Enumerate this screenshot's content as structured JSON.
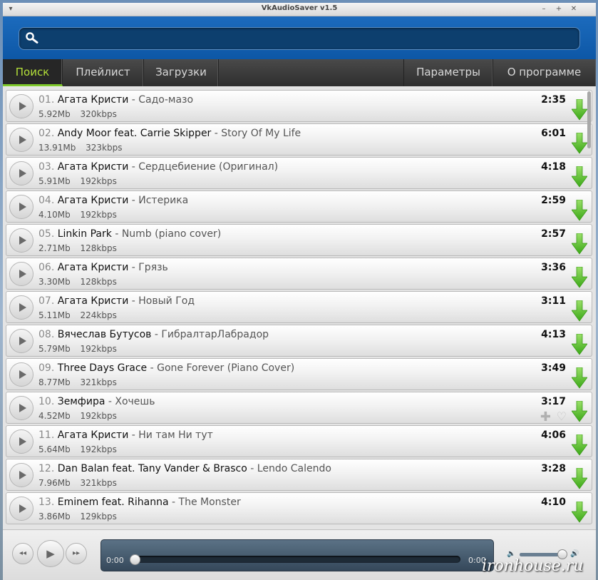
{
  "window": {
    "title": "VkAudioSaver v1.5"
  },
  "search": {
    "placeholder": "",
    "value": ""
  },
  "tabs": [
    {
      "label": "Поиск",
      "active": true
    },
    {
      "label": "Плейлист",
      "active": false
    },
    {
      "label": "Загрузки",
      "active": false
    }
  ],
  "right_tabs": [
    {
      "label": "Параметры"
    },
    {
      "label": "О программе"
    }
  ],
  "tracks": [
    {
      "num": "01.",
      "artist": "Агата Кристи",
      "title": "Садо-мазо",
      "size": "5.92Mb",
      "bitrate": "320kbps",
      "duration": "2:35"
    },
    {
      "num": "02.",
      "artist": "Andy Moor feat. Carrie Skipper",
      "title": "Story Of My Life",
      "size": "13.91Mb",
      "bitrate": "323kbps",
      "duration": "6:01"
    },
    {
      "num": "03.",
      "artist": "Агата Кристи",
      "title": "Сердцебиение (Оригинал)",
      "size": "5.91Mb",
      "bitrate": "192kbps",
      "duration": "4:18"
    },
    {
      "num": "04.",
      "artist": "Агата Кристи",
      "title": "Истерика",
      "size": "4.10Mb",
      "bitrate": "192kbps",
      "duration": "2:59"
    },
    {
      "num": "05.",
      "artist": "Linkin Park",
      "title": "Numb (piano cover)",
      "size": "2.71Mb",
      "bitrate": "128kbps",
      "duration": "2:57"
    },
    {
      "num": "06.",
      "artist": "Агата Кристи",
      "title": "Грязь",
      "size": "3.30Mb",
      "bitrate": "128kbps",
      "duration": "3:36"
    },
    {
      "num": "07.",
      "artist": "Агата Кристи",
      "title": "Новый Год",
      "size": "5.11Mb",
      "bitrate": "224kbps",
      "duration": "3:11"
    },
    {
      "num": "08.",
      "artist": "Вячеслав Бутусов",
      "title": "ГибралтарЛабрадор",
      "size": "5.79Mb",
      "bitrate": "192kbps",
      "duration": "4:13"
    },
    {
      "num": "09.",
      "artist": "Three Days Grace",
      "title": "Gone Forever (Piano Cover)",
      "size": "8.77Mb",
      "bitrate": "321kbps",
      "duration": "3:49"
    },
    {
      "num": "10.",
      "artist": "Земфира",
      "title": "Хочешь",
      "size": "4.52Mb",
      "bitrate": "192kbps",
      "duration": "3:17",
      "hover": true
    },
    {
      "num": "11.",
      "artist": "Агата Кристи",
      "title": "Ни там Ни тут",
      "size": "5.64Mb",
      "bitrate": "192kbps",
      "duration": "4:06"
    },
    {
      "num": "12.",
      "artist": "Dan Balan feat. Tany Vander & Brasco",
      "title": "Lendo Calendo",
      "size": "7.96Mb",
      "bitrate": "321kbps",
      "duration": "3:28"
    },
    {
      "num": "13.",
      "artist": "Eminem feat. Rihanna",
      "title": "The Monster",
      "size": "3.86Mb",
      "bitrate": "129kbps",
      "duration": "4:10"
    }
  ],
  "player": {
    "current_time": "0:00",
    "total_time": "0:00",
    "progress": 0,
    "volume": 0.9
  },
  "watermark": "ironhouse.ru",
  "colors": {
    "header_blue": "#0d57a6",
    "active_tab_green": "#7ec82a",
    "download_green": "#5fc32a"
  }
}
